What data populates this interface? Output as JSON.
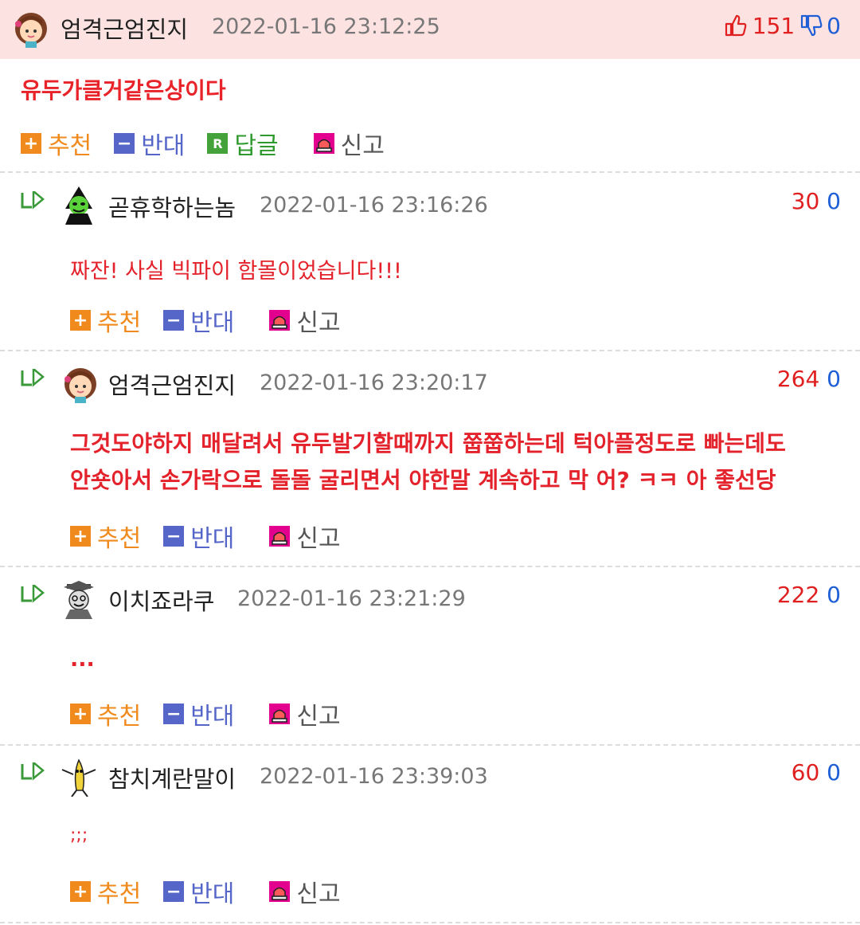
{
  "main_comment": {
    "author": "엄격근엄진지",
    "date": "2022-01-16 23:12:25",
    "up": "151",
    "down": "0",
    "text": "유두가클거같은상이다",
    "actions": {
      "recommend": "추천",
      "oppose": "반대",
      "reply": "답글",
      "report": "신고",
      "reply_icon_letter": "R"
    }
  },
  "replies": [
    {
      "author": "곧휴학하는놈",
      "date": "2022-01-16 23:16:26",
      "up": "30",
      "down": "0",
      "lines": [
        "짜잔! 사실 빅파이 함몰이었습니다!!!"
      ],
      "actions": {
        "recommend": "추천",
        "oppose": "반대",
        "report": "신고"
      }
    },
    {
      "author": "엄격근엄진지",
      "date": "2022-01-16 23:20:17",
      "up": "264",
      "down": "0",
      "lines": [
        "그것도야하지 매달려서 유두발기할때까지 쭙쭙하는데 턱아플정도로 빠는데도",
        "안숏아서 손가락으로 돌돌 굴리면서 야한말 계속하고 막 어? ㅋㅋ 아 좋선당"
      ],
      "actions": {
        "recommend": "추천",
        "oppose": "반대",
        "report": "신고"
      }
    },
    {
      "author": "이치죠라쿠",
      "date": "2022-01-16 23:21:29",
      "up": "222",
      "down": "0",
      "lines": [
        "..."
      ],
      "actions": {
        "recommend": "추천",
        "oppose": "반대",
        "report": "신고"
      }
    },
    {
      "author": "참치계란말이",
      "date": "2022-01-16 23:39:03",
      "up": "60",
      "down": "0",
      "lines": [
        ";;;"
      ],
      "actions": {
        "recommend": "추천",
        "oppose": "반대",
        "report": "신고"
      }
    }
  ],
  "colors": {
    "accent_red": "#e8232a",
    "down_blue": "#1f5fd6",
    "header_bg": "#fde2e2"
  }
}
